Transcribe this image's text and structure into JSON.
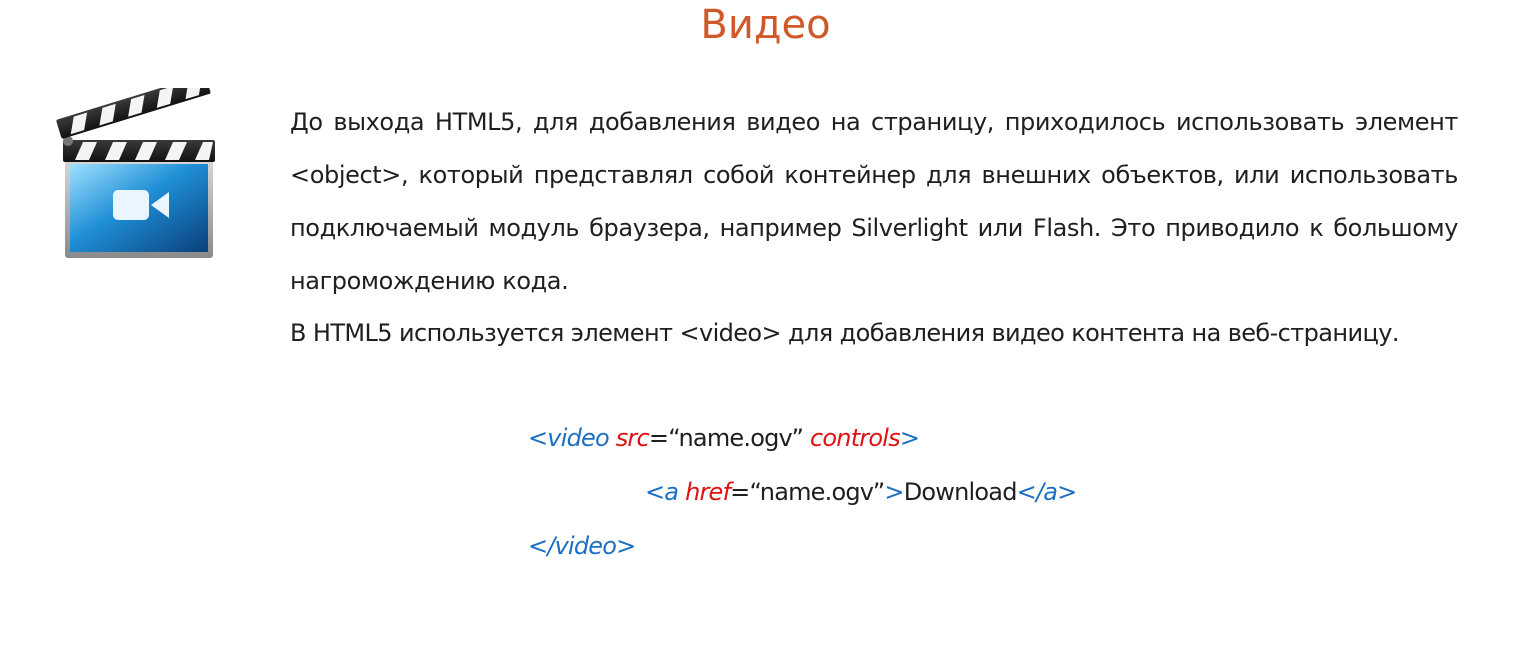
{
  "slide": {
    "title": "Видео",
    "paragraph1": "До выхода HTML5, для добавления видео на страницу, приходилось использовать элемент <object>, который представлял собой контейнер для внешних объектов, или использовать подключаемый модуль браузера, например Silverlight или Flash. Это приводило к большому нагромождению кода.",
    "paragraph2": "В HTML5 используется элемент <video> для добавления видео контента на веб-страницу."
  },
  "code": {
    "line1": {
      "open": "<video",
      "attr_src": "src",
      "eq_value": "=“name.ogv”",
      "attr_controls": "controls",
      "close": ">"
    },
    "line2": {
      "open": "<a",
      "attr_href": "href",
      "eq_value": "=“name.ogv”",
      "close": ">",
      "text": "Download",
      "end_tag": "</a>"
    },
    "line3": {
      "end_tag": "</video>"
    }
  },
  "icons": {
    "clapperboard": "video-clapperboard-icon"
  },
  "colors": {
    "title": "#d0592a",
    "tag": "#1a6fc2",
    "attribute": "#e01111",
    "text": "#1f1f1f"
  }
}
